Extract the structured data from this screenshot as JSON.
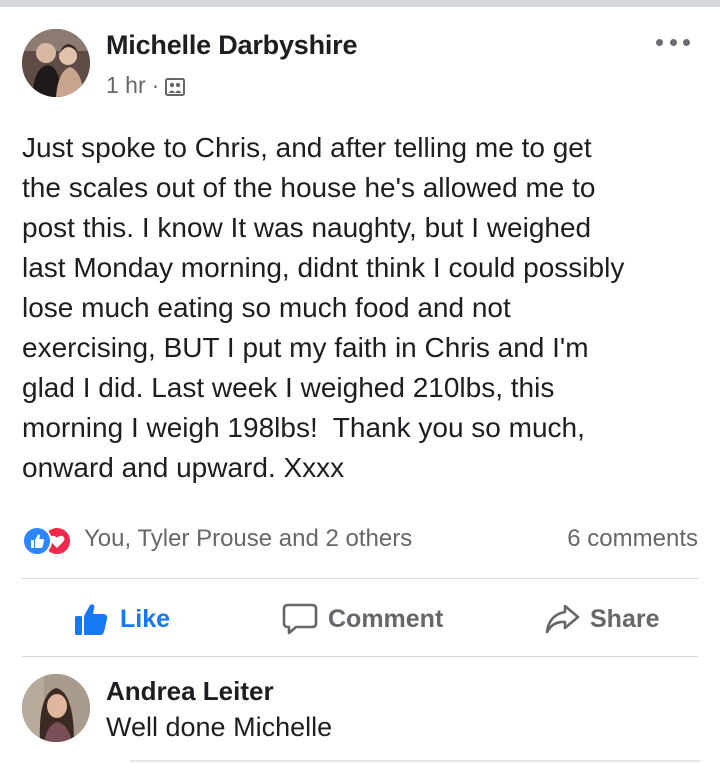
{
  "post": {
    "author": "Michelle Darbyshire",
    "time": "1 hr",
    "separator": "·",
    "audience_icon": "friends-audience-icon",
    "more_icon": "more-options-icon",
    "text": "Just spoke to Chris, and after telling me to get\nthe scales out of the house he's allowed me to\npost this. I know It was naughty, but I weighed\nlast Monday morning, didnt think I could possibly\nlose much eating so much food and not\nexercising, BUT I put my faith in Chris and I'm\nglad I did. Last week I weighed 210lbs, this\nmorning I weigh 198lbs!  Thank you so much,\nonward and upward. Xxxx"
  },
  "reactions": {
    "icons": [
      "like-reaction-icon",
      "love-reaction-icon"
    ],
    "summary": "You, Tyler Prouse and 2 others",
    "comments": "6 comments"
  },
  "actions": {
    "like": "Like",
    "comment": "Comment",
    "share": "Share"
  },
  "comments": [
    {
      "author": "Andrea Leiter",
      "text": "Well done Michelle"
    }
  ],
  "colors": {
    "like_blue": "#1877f2",
    "love_red": "#f0284a",
    "secondary_text": "#65676b",
    "primary_text": "#1c1e21"
  }
}
